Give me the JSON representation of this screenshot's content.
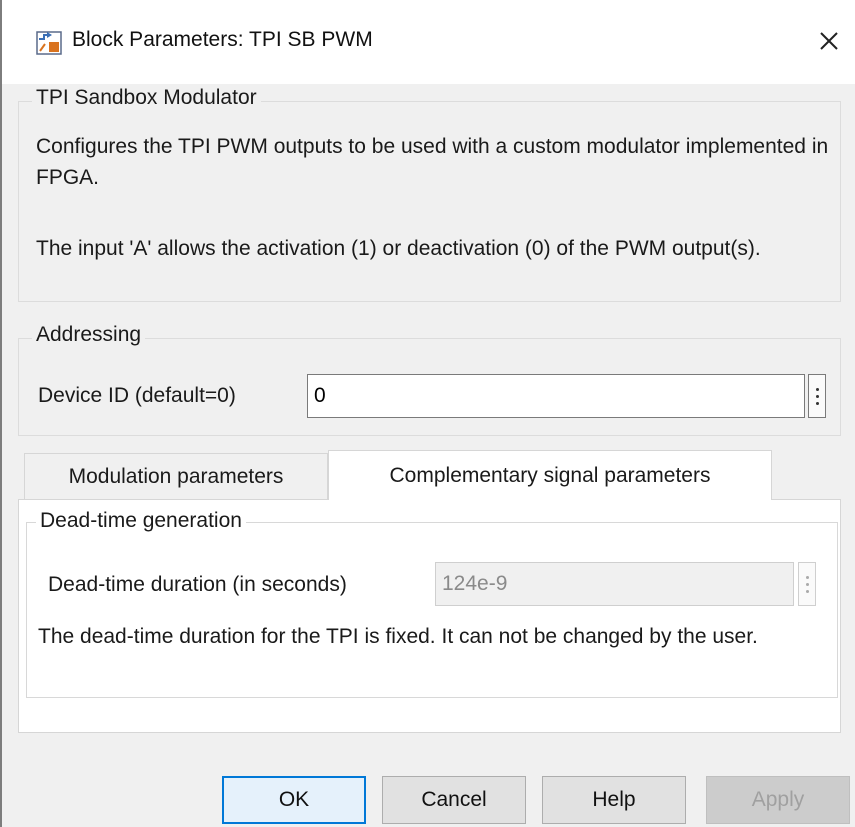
{
  "window": {
    "title": "Block Parameters: TPI SB PWM",
    "icons": {
      "app": "simulink-block-icon",
      "close": "close-icon"
    }
  },
  "block_group": {
    "title": "TPI Sandbox Modulator",
    "description_1": "Configures the TPI PWM outputs to be used with a custom modulator implemented in FPGA.",
    "description_2": "The input 'A' allows the activation (1) or deactivation (0) of the PWM output(s)."
  },
  "addressing_group": {
    "title": "Addressing",
    "device_id_label": "Device ID (default=0)",
    "device_id_value": "0"
  },
  "tabs": [
    {
      "label": "Modulation parameters",
      "active": false
    },
    {
      "label": "Complementary signal parameters",
      "active": true
    }
  ],
  "deadtime_group": {
    "title": "Dead-time generation",
    "duration_label": "Dead-time duration (in seconds)",
    "duration_value": "124e-9",
    "note": "The dead-time duration for the TPI is fixed. It can not be changed by the user."
  },
  "buttons": {
    "ok": "OK",
    "cancel": "Cancel",
    "help": "Help",
    "apply": "Apply"
  },
  "colors": {
    "dialog_bg": "#f0f0f0",
    "accent": "#0078d7",
    "disabled_text": "#8a8a8a"
  }
}
